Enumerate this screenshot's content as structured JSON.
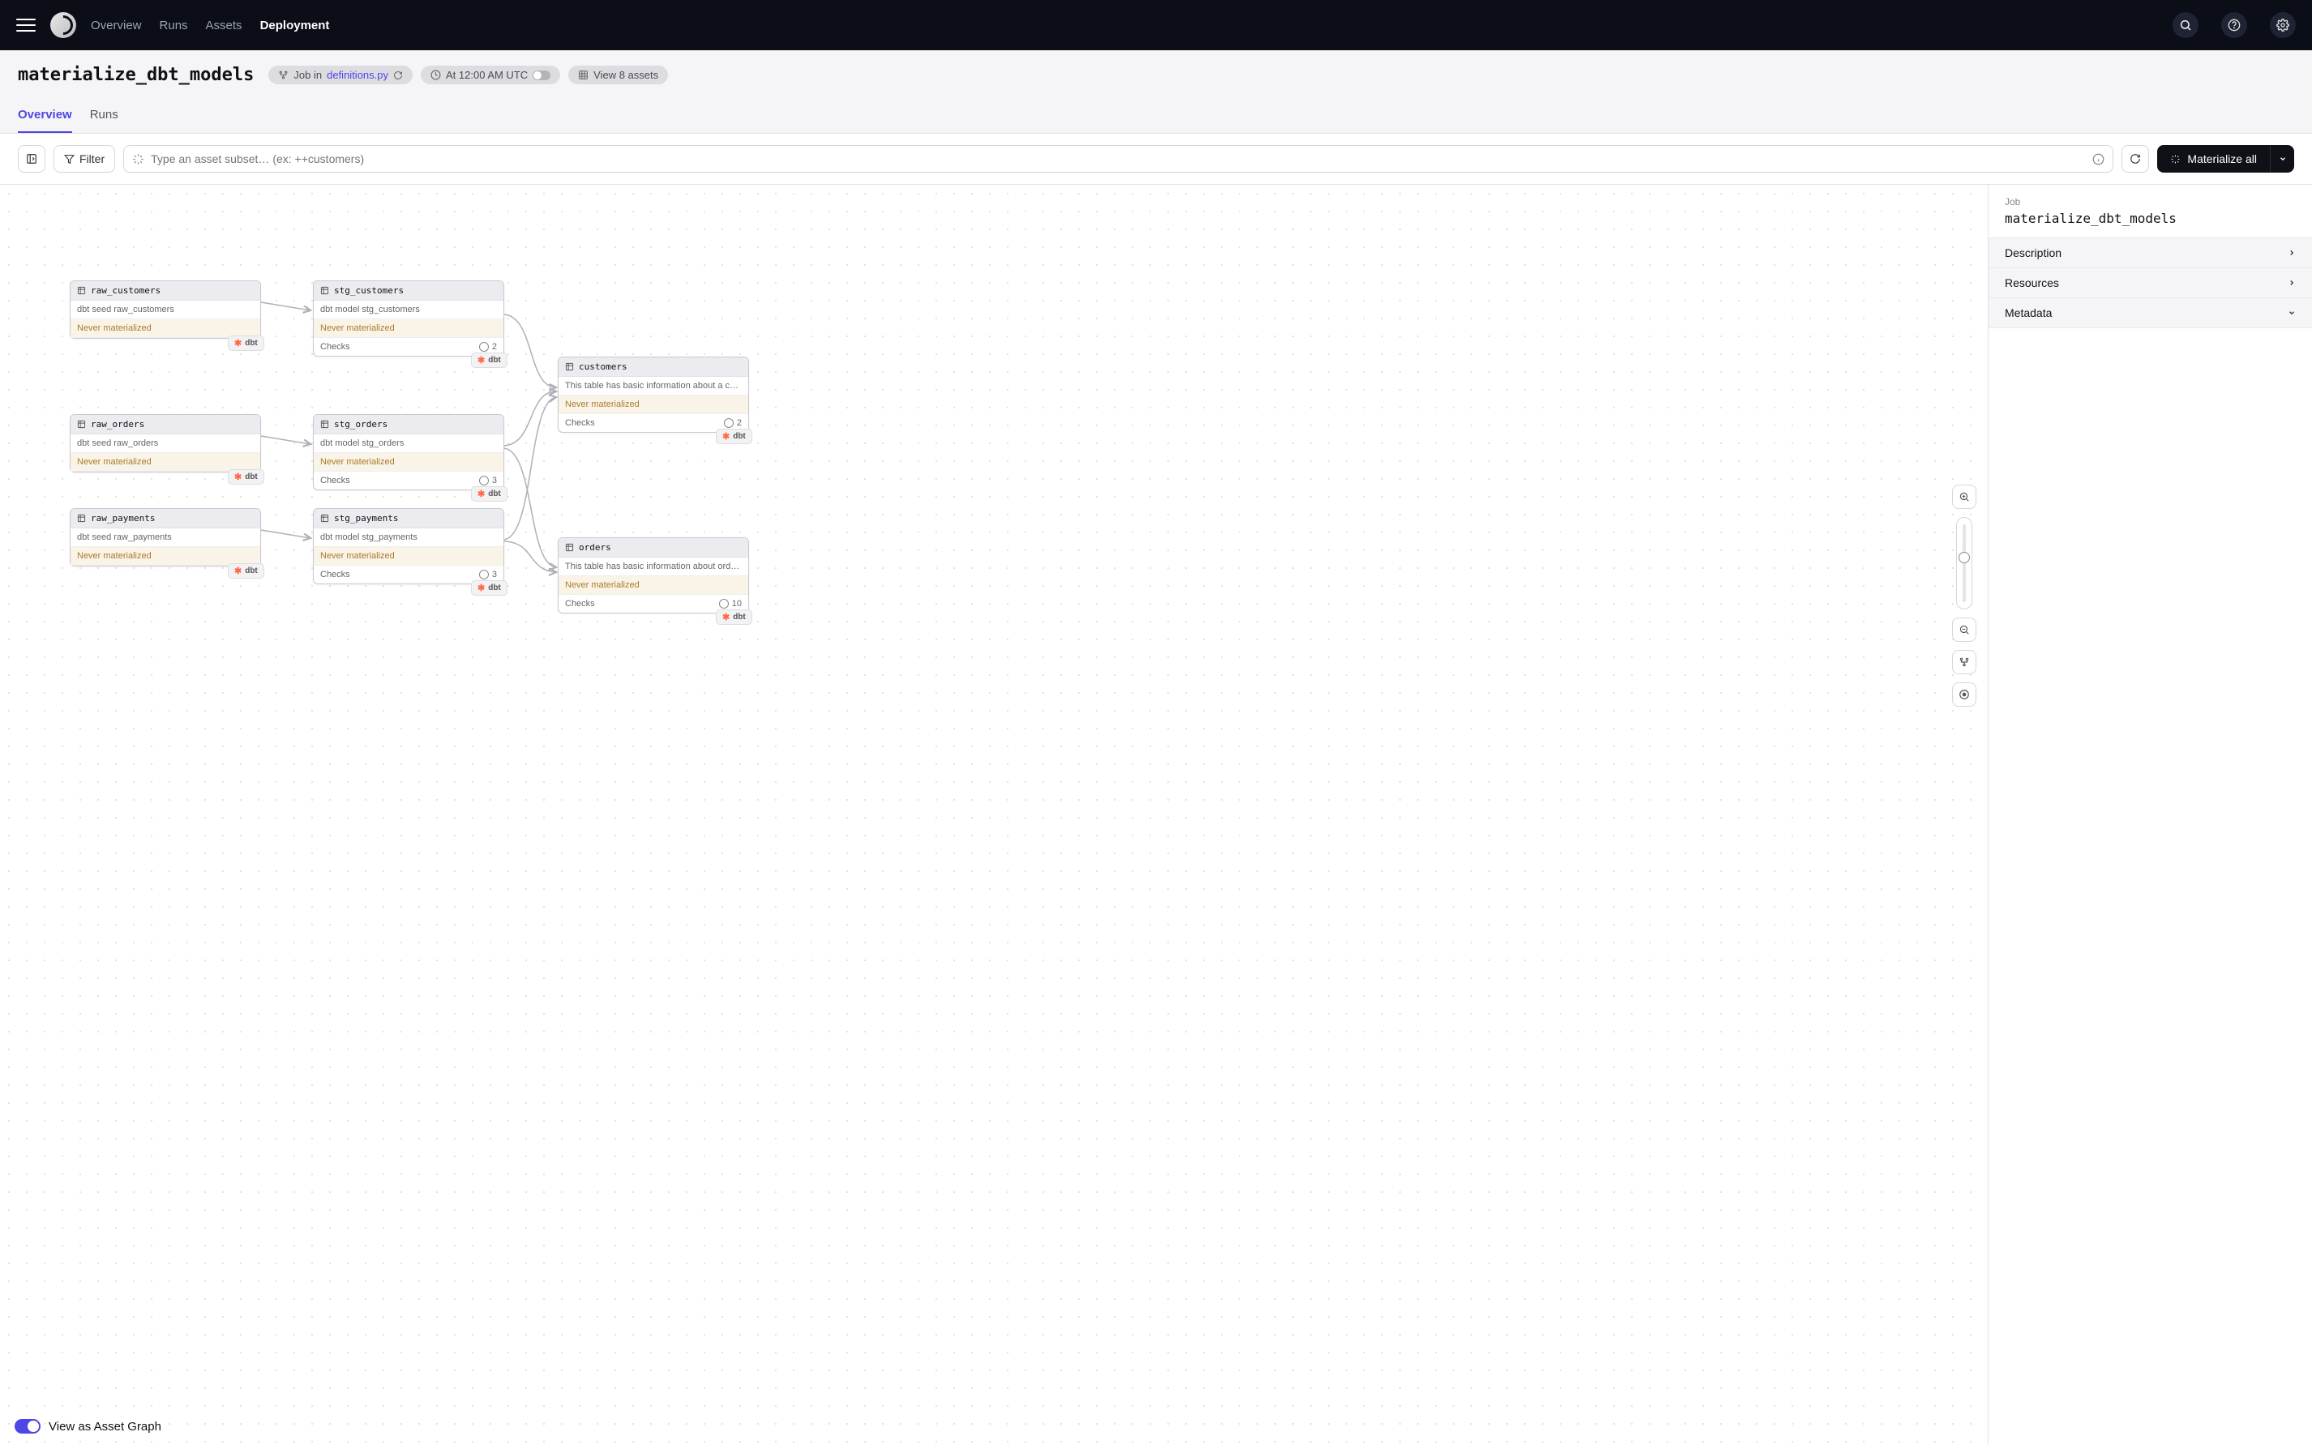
{
  "nav": {
    "overview": "Overview",
    "runs": "Runs",
    "assets": "Assets",
    "deployment": "Deployment"
  },
  "page": {
    "title": "materialize_dbt_models",
    "job_in_prefix": "Job in ",
    "job_in_file": "definitions.py",
    "schedule": "At 12:00 AM UTC",
    "view_assets": "View 8 assets"
  },
  "tabs": {
    "overview": "Overview",
    "runs": "Runs"
  },
  "toolbar": {
    "filter": "Filter",
    "search_placeholder": "Type an asset subset… (ex: ++customers)",
    "materialize_all": "Materialize all"
  },
  "sidepanel": {
    "job_label": "Job",
    "job_name": "materialize_dbt_models",
    "description": "Description",
    "resources": "Resources",
    "metadata": "Metadata"
  },
  "common": {
    "never_materialized": "Never materialized",
    "checks": "Checks",
    "dbt": "dbt"
  },
  "nodes": {
    "raw_customers": {
      "title": "raw_customers",
      "desc": "dbt seed raw_customers"
    },
    "raw_orders": {
      "title": "raw_orders",
      "desc": "dbt seed raw_orders"
    },
    "raw_payments": {
      "title": "raw_payments",
      "desc": "dbt seed raw_payments"
    },
    "stg_customers": {
      "title": "stg_customers",
      "desc": "dbt model stg_customers",
      "checks": "2"
    },
    "stg_orders": {
      "title": "stg_orders",
      "desc": "dbt model stg_orders",
      "checks": "3"
    },
    "stg_payments": {
      "title": "stg_payments",
      "desc": "dbt model stg_payments",
      "checks": "3"
    },
    "customers": {
      "title": "customers",
      "desc": "This table has basic information about a custo…",
      "checks": "2"
    },
    "orders": {
      "title": "orders",
      "desc": "This table has basic information about orders, a…",
      "checks": "10"
    }
  },
  "bottom": {
    "view_as_graph": "View as Asset Graph"
  }
}
